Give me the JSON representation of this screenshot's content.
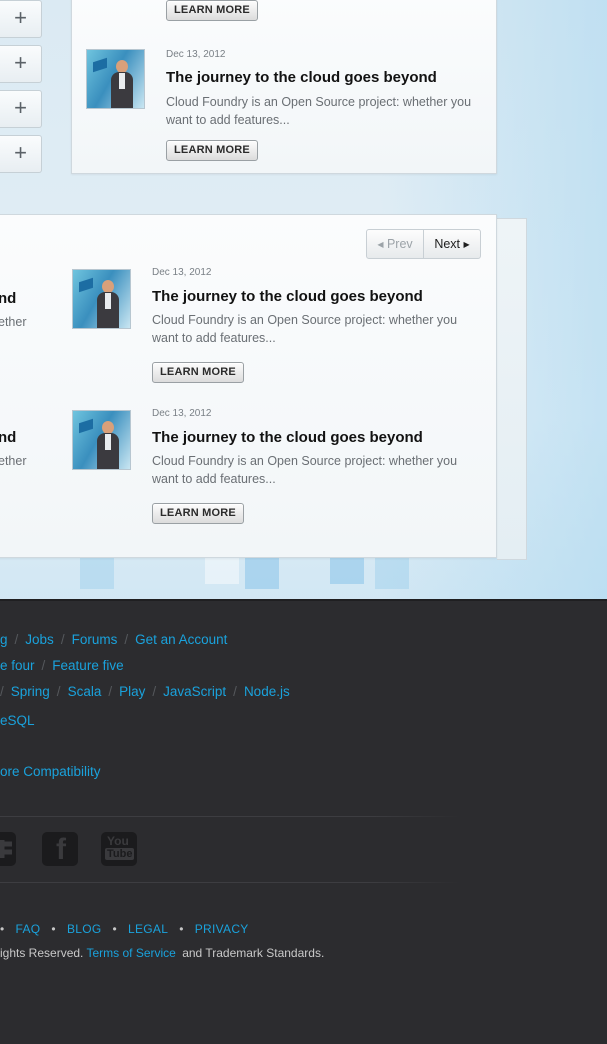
{
  "accordion": {
    "expand_symbol": "+"
  },
  "articles_top": [
    {
      "learn_more": "LEARN MORE"
    },
    {
      "date": "Dec 13, 2012",
      "title": "The journey to the cloud goes beyond",
      "desc": "Cloud Foundry is an Open Source project: whether you want to add features...",
      "learn_more": "LEARN MORE"
    }
  ],
  "pager": {
    "prev": "Prev",
    "next": "Next"
  },
  "articles_left_cut": [
    {
      "title_end": "nd",
      "desc_end": "ether"
    },
    {
      "title_end": "nd",
      "desc_end": "ether"
    }
  ],
  "articles": [
    {
      "date": "Dec 13, 2012",
      "title": "The journey to the cloud goes beyond",
      "desc": "Cloud Foundry is an Open Source project: whether you want to add features...",
      "learn_more": "LEARN MORE"
    },
    {
      "date": "Dec 13, 2012",
      "title": "The journey to the cloud goes beyond",
      "desc": "Cloud Foundry is an Open Source project: whether you want to add features...",
      "learn_more": "LEARN MORE"
    }
  ],
  "footer": {
    "row1": [
      "g",
      "Jobs",
      "Forums",
      "Get an Account"
    ],
    "row2": [
      "e four",
      "Feature five"
    ],
    "row3": [
      "Spring",
      "Scala",
      "Play",
      "JavaScript",
      "Node.js"
    ],
    "row4": [
      "eSQL"
    ],
    "row5": [
      "ore Compatibility"
    ],
    "social": [
      "twitter-icon",
      "facebook-icon",
      "youtube-icon"
    ],
    "youtube_text": [
      "You",
      "Tube"
    ],
    "facebook_glyph": "f",
    "legal_links": [
      "FAQ",
      "BLOG",
      "LEGAL",
      "PRIVACY"
    ],
    "legal_sep": "•",
    "copyright_prefix": "ights Reserved.",
    "terms_link": "Terms of Service",
    "copyright_suffix": "and Trademark Standards."
  },
  "colors": {
    "link": "#1aa2dc",
    "footer_bg": "#2c2c2f"
  }
}
